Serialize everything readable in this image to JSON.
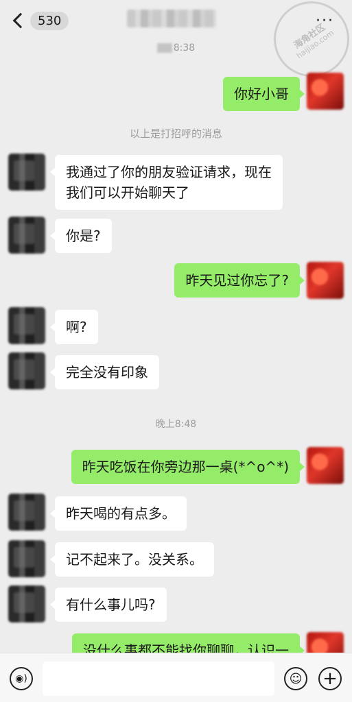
{
  "header": {
    "unread_count": "530",
    "more_label": "···"
  },
  "watermark": {
    "line1": "海角社区",
    "line2": "haijiao.com"
  },
  "timestamps": {
    "first": "8:38",
    "second": "晚上8:48"
  },
  "system_note": "以上是打招呼的消息",
  "messages": [
    {
      "side": "out",
      "text": "你好小哥"
    },
    {
      "side": "in",
      "lines": [
        "我通过了你的朋友验证请求，现在",
        "我们可以开始聊天了"
      ]
    },
    {
      "side": "in",
      "text": "你是?"
    },
    {
      "side": "out",
      "text": "昨天见过你忘了?"
    },
    {
      "side": "in",
      "text": "啊?"
    },
    {
      "side": "in",
      "text": "完全没有印象"
    },
    {
      "side": "out",
      "text": "昨天吃饭在你旁边那一桌(*^o^*)"
    },
    {
      "side": "in",
      "text": "昨天喝的有点多。"
    },
    {
      "side": "in",
      "text": "记不起来了。没关系。"
    },
    {
      "side": "in",
      "text": "有什么事儿吗?"
    },
    {
      "side": "out",
      "text": "没什么事都不能找你聊聊，认识一"
    }
  ],
  "input_bar": {
    "voice_icon": "voice-icon",
    "emoji_icon": "emoji-icon",
    "plus_icon": "plus-icon",
    "emoji_glyph": "☺",
    "plus_glyph": "+",
    "voice_glyph": "◉)",
    "input_value": ""
  },
  "colors": {
    "background": "#ededed",
    "outgoing_bubble": "#95ec69",
    "incoming_bubble": "#ffffff"
  }
}
